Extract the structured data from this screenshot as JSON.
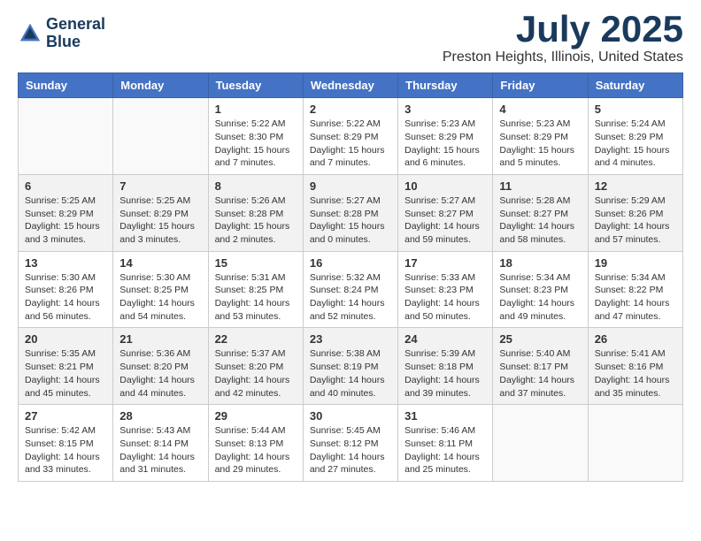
{
  "header": {
    "logo_line1": "General",
    "logo_line2": "Blue",
    "month": "July 2025",
    "location": "Preston Heights, Illinois, United States"
  },
  "weekdays": [
    "Sunday",
    "Monday",
    "Tuesday",
    "Wednesday",
    "Thursday",
    "Friday",
    "Saturday"
  ],
  "weeks": [
    [
      {
        "day": "",
        "info": ""
      },
      {
        "day": "",
        "info": ""
      },
      {
        "day": "1",
        "info": "Sunrise: 5:22 AM\nSunset: 8:30 PM\nDaylight: 15 hours\nand 7 minutes."
      },
      {
        "day": "2",
        "info": "Sunrise: 5:22 AM\nSunset: 8:29 PM\nDaylight: 15 hours\nand 7 minutes."
      },
      {
        "day": "3",
        "info": "Sunrise: 5:23 AM\nSunset: 8:29 PM\nDaylight: 15 hours\nand 6 minutes."
      },
      {
        "day": "4",
        "info": "Sunrise: 5:23 AM\nSunset: 8:29 PM\nDaylight: 15 hours\nand 5 minutes."
      },
      {
        "day": "5",
        "info": "Sunrise: 5:24 AM\nSunset: 8:29 PM\nDaylight: 15 hours\nand 4 minutes."
      }
    ],
    [
      {
        "day": "6",
        "info": "Sunrise: 5:25 AM\nSunset: 8:29 PM\nDaylight: 15 hours\nand 3 minutes."
      },
      {
        "day": "7",
        "info": "Sunrise: 5:25 AM\nSunset: 8:29 PM\nDaylight: 15 hours\nand 3 minutes."
      },
      {
        "day": "8",
        "info": "Sunrise: 5:26 AM\nSunset: 8:28 PM\nDaylight: 15 hours\nand 2 minutes."
      },
      {
        "day": "9",
        "info": "Sunrise: 5:27 AM\nSunset: 8:28 PM\nDaylight: 15 hours\nand 0 minutes."
      },
      {
        "day": "10",
        "info": "Sunrise: 5:27 AM\nSunset: 8:27 PM\nDaylight: 14 hours\nand 59 minutes."
      },
      {
        "day": "11",
        "info": "Sunrise: 5:28 AM\nSunset: 8:27 PM\nDaylight: 14 hours\nand 58 minutes."
      },
      {
        "day": "12",
        "info": "Sunrise: 5:29 AM\nSunset: 8:26 PM\nDaylight: 14 hours\nand 57 minutes."
      }
    ],
    [
      {
        "day": "13",
        "info": "Sunrise: 5:30 AM\nSunset: 8:26 PM\nDaylight: 14 hours\nand 56 minutes."
      },
      {
        "day": "14",
        "info": "Sunrise: 5:30 AM\nSunset: 8:25 PM\nDaylight: 14 hours\nand 54 minutes."
      },
      {
        "day": "15",
        "info": "Sunrise: 5:31 AM\nSunset: 8:25 PM\nDaylight: 14 hours\nand 53 minutes."
      },
      {
        "day": "16",
        "info": "Sunrise: 5:32 AM\nSunset: 8:24 PM\nDaylight: 14 hours\nand 52 minutes."
      },
      {
        "day": "17",
        "info": "Sunrise: 5:33 AM\nSunset: 8:23 PM\nDaylight: 14 hours\nand 50 minutes."
      },
      {
        "day": "18",
        "info": "Sunrise: 5:34 AM\nSunset: 8:23 PM\nDaylight: 14 hours\nand 49 minutes."
      },
      {
        "day": "19",
        "info": "Sunrise: 5:34 AM\nSunset: 8:22 PM\nDaylight: 14 hours\nand 47 minutes."
      }
    ],
    [
      {
        "day": "20",
        "info": "Sunrise: 5:35 AM\nSunset: 8:21 PM\nDaylight: 14 hours\nand 45 minutes."
      },
      {
        "day": "21",
        "info": "Sunrise: 5:36 AM\nSunset: 8:20 PM\nDaylight: 14 hours\nand 44 minutes."
      },
      {
        "day": "22",
        "info": "Sunrise: 5:37 AM\nSunset: 8:20 PM\nDaylight: 14 hours\nand 42 minutes."
      },
      {
        "day": "23",
        "info": "Sunrise: 5:38 AM\nSunset: 8:19 PM\nDaylight: 14 hours\nand 40 minutes."
      },
      {
        "day": "24",
        "info": "Sunrise: 5:39 AM\nSunset: 8:18 PM\nDaylight: 14 hours\nand 39 minutes."
      },
      {
        "day": "25",
        "info": "Sunrise: 5:40 AM\nSunset: 8:17 PM\nDaylight: 14 hours\nand 37 minutes."
      },
      {
        "day": "26",
        "info": "Sunrise: 5:41 AM\nSunset: 8:16 PM\nDaylight: 14 hours\nand 35 minutes."
      }
    ],
    [
      {
        "day": "27",
        "info": "Sunrise: 5:42 AM\nSunset: 8:15 PM\nDaylight: 14 hours\nand 33 minutes."
      },
      {
        "day": "28",
        "info": "Sunrise: 5:43 AM\nSunset: 8:14 PM\nDaylight: 14 hours\nand 31 minutes."
      },
      {
        "day": "29",
        "info": "Sunrise: 5:44 AM\nSunset: 8:13 PM\nDaylight: 14 hours\nand 29 minutes."
      },
      {
        "day": "30",
        "info": "Sunrise: 5:45 AM\nSunset: 8:12 PM\nDaylight: 14 hours\nand 27 minutes."
      },
      {
        "day": "31",
        "info": "Sunrise: 5:46 AM\nSunset: 8:11 PM\nDaylight: 14 hours\nand 25 minutes."
      },
      {
        "day": "",
        "info": ""
      },
      {
        "day": "",
        "info": ""
      }
    ]
  ]
}
